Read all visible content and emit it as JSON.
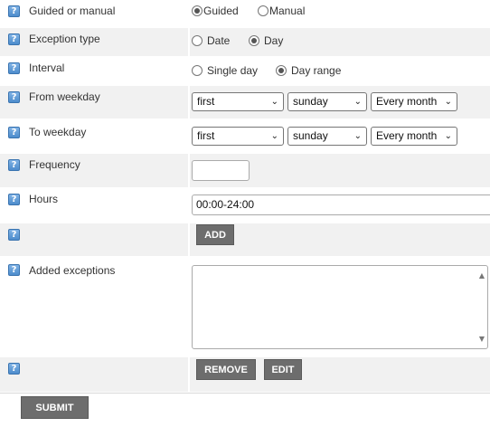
{
  "help_icon_glyph": "?",
  "rows": {
    "guided": {
      "label": "Guided or manual",
      "options": [
        "Guided",
        "Manual"
      ],
      "selected": "Guided"
    },
    "exception_type": {
      "label": "Exception type",
      "options": [
        "Date",
        "Day"
      ],
      "selected": "Day"
    },
    "interval": {
      "label": "Interval",
      "options": [
        "Single day",
        "Day range"
      ],
      "selected": "Day range"
    },
    "from_weekday": {
      "label": "From weekday",
      "ordinal": "first",
      "weekday": "sunday",
      "period": "Every month"
    },
    "to_weekday": {
      "label": "To weekday",
      "ordinal": "first",
      "weekday": "sunday",
      "period": "Every month"
    },
    "frequency": {
      "label": "Frequency",
      "value": ""
    },
    "hours": {
      "label": "Hours",
      "value": "00:00-24:00"
    },
    "add": {
      "button": "ADD"
    },
    "added_exceptions": {
      "label": "Added exceptions",
      "items": []
    },
    "actions": {
      "remove": "REMOVE",
      "edit": "EDIT"
    }
  },
  "submit": "SUBMIT",
  "chevron_glyph": "⌄"
}
